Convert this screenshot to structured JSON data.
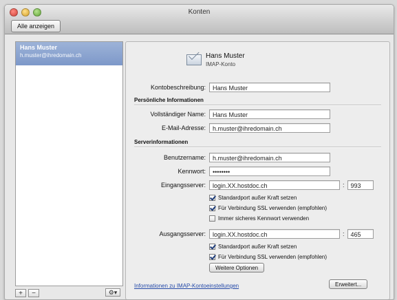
{
  "window": {
    "title": "Konten",
    "show_all": "Alle anzeigen"
  },
  "sidebar": {
    "account_title": "Hans Muster",
    "account_subtitle": "h.muster@ihredomain.ch",
    "add_label": "+",
    "remove_label": "−",
    "gear_label": "⚙▾"
  },
  "account": {
    "name": "Hans Muster",
    "type": "IMAP-Konto",
    "description_label": "Kontobeschreibung:",
    "description_value": "Hans Muster"
  },
  "personal": {
    "header": "Persönliche Informationen",
    "fullname_label": "Vollständiger Name:",
    "fullname_value": "Hans Muster",
    "email_label": "E-Mail-Adresse:",
    "email_value": "h.muster@ihredomain.ch"
  },
  "server": {
    "header": "Serverinformationen",
    "username_label": "Benutzername:",
    "username_value": "h.muster@ihredomain.ch",
    "password_label": "Kennwort:",
    "password_value": "••••••••",
    "incoming_label": "Eingangsserver:",
    "incoming_value": "login.XX.hostdoc.ch",
    "incoming_port": "993",
    "incoming_opt1": "Standardport außer Kraft setzen",
    "incoming_opt2": "Für Verbindung SSL verwenden (empfohlen)",
    "incoming_opt3": "Immer sicheres Kennwort verwenden",
    "outgoing_label": "Ausgangsserver:",
    "outgoing_value": "login.XX.hostdoc.ch",
    "outgoing_port": "465",
    "outgoing_opt1": "Standardport außer Kraft setzen",
    "outgoing_opt2": "Für Verbindung SSL verwenden (empfohlen)",
    "more_options": "Weitere Optionen",
    "help_link": "Informationen zu IMAP-Kontoeinstellungen",
    "advanced_button": "Erweitert..."
  }
}
